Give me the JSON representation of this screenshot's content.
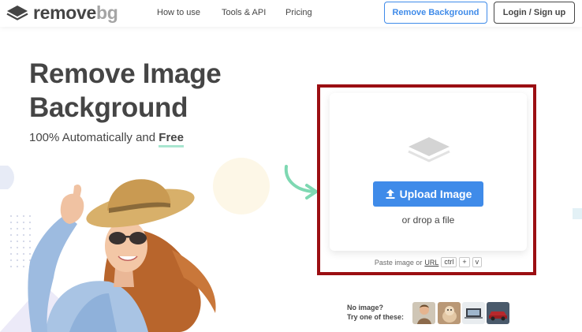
{
  "header": {
    "logo": {
      "text_a": "remove",
      "text_b": "bg"
    },
    "nav": [
      "How to use",
      "Tools & API",
      "Pricing"
    ],
    "remove_bg_button": "Remove Background",
    "login_button": "Login / Sign up"
  },
  "hero": {
    "title_line1": "Remove Image",
    "title_line2": "Background",
    "subtitle_prefix": "100% Automatically and",
    "subtitle_emphasis": "Free"
  },
  "upload": {
    "icon": "layers-icon",
    "button_label": "Upload Image",
    "drop_text": "or drop a file",
    "paste_prefix": "Paste image or",
    "paste_url": "URL",
    "keys": [
      "ctrl",
      "+",
      "v"
    ]
  },
  "samples": {
    "label_line1": "No image?",
    "label_line2": "Try one of these:",
    "thumbnails": [
      "sample-person-thumb",
      "sample-animal-thumb",
      "sample-product-thumb",
      "sample-car-thumb"
    ]
  },
  "colors": {
    "accent_blue": "#3f8be9",
    "text_dark": "#454545",
    "highlight_red": "#9b0e12",
    "free_underline": "#a8e6cf",
    "arrow_green": "#7ed8b2"
  }
}
